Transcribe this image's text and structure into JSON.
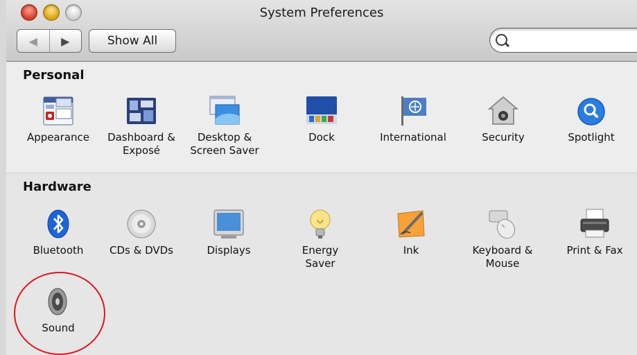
{
  "window": {
    "title": "System Preferences"
  },
  "toolbar": {
    "back_icon": "back-arrow-icon",
    "forward_icon": "forward-arrow-icon",
    "show_all_label": "Show All",
    "search_value": ""
  },
  "sections": {
    "personal": {
      "title": "Personal",
      "items": [
        {
          "label": "Appearance",
          "icon": "appearance-icon"
        },
        {
          "label": "Dashboard &\nExposé",
          "icon": "dashboard-icon"
        },
        {
          "label": "Desktop &\nScreen Saver",
          "icon": "desktop-icon"
        },
        {
          "label": "Dock",
          "icon": "dock-icon"
        },
        {
          "label": "International",
          "icon": "international-flag-icon"
        },
        {
          "label": "Security",
          "icon": "security-house-icon"
        },
        {
          "label": "Spotlight",
          "icon": "spotlight-icon"
        }
      ]
    },
    "hardware": {
      "title": "Hardware",
      "items": [
        {
          "label": "Bluetooth",
          "icon": "bluetooth-icon"
        },
        {
          "label": "CDs & DVDs",
          "icon": "cd-dvd-icon"
        },
        {
          "label": "Displays",
          "icon": "display-icon"
        },
        {
          "label": "Energy\nSaver",
          "icon": "lightbulb-icon"
        },
        {
          "label": "Ink",
          "icon": "ink-pen-icon"
        },
        {
          "label": "Keyboard &\nMouse",
          "icon": "keyboard-mouse-icon"
        },
        {
          "label": "Print & Fax",
          "icon": "printer-icon"
        },
        {
          "label": "Sound",
          "icon": "speaker-icon"
        }
      ]
    }
  },
  "annotation": {
    "color": "#e0141e",
    "icon": "red-circle-highlight"
  }
}
